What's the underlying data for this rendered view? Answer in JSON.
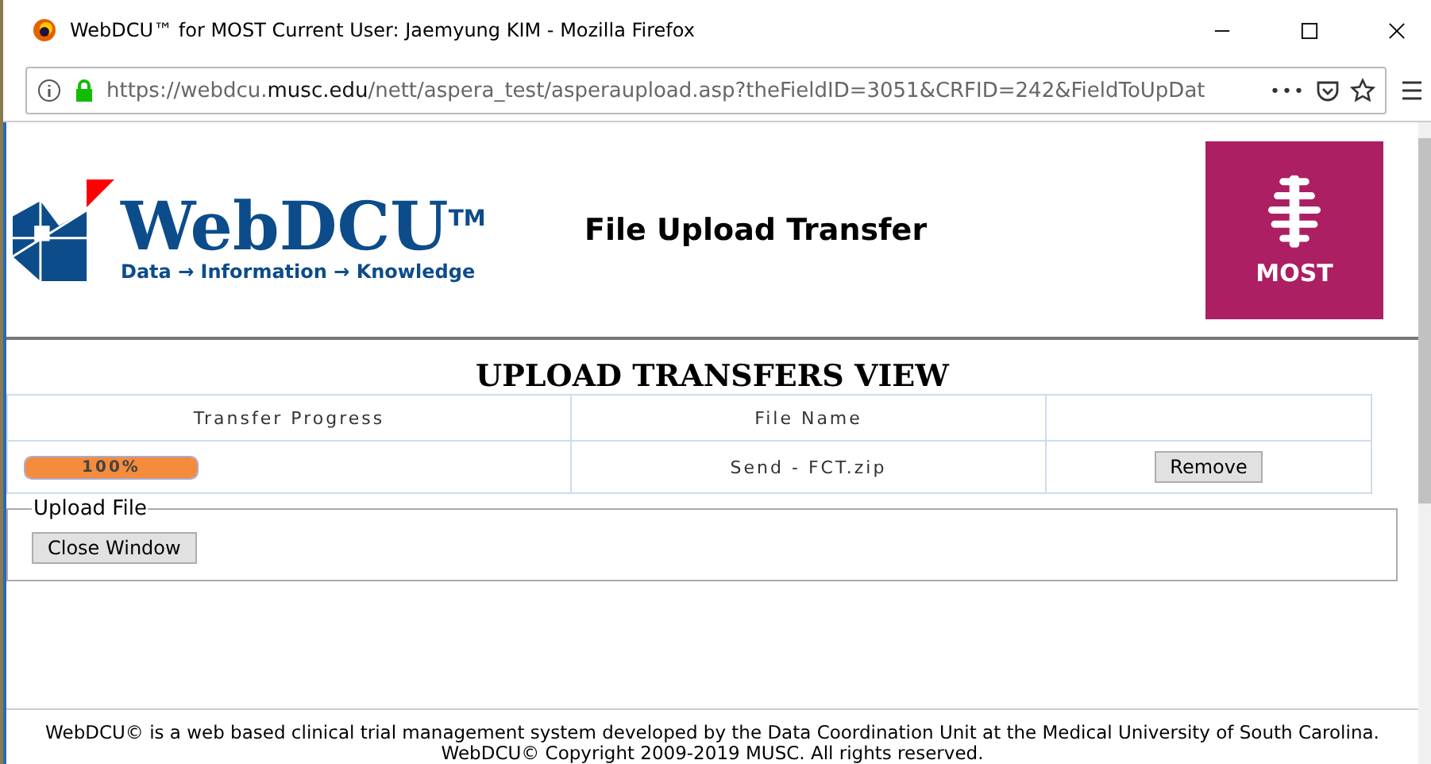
{
  "window": {
    "title": "WebDCU™ for MOST  Current User: Jaemyung KIM - Mozilla Firefox"
  },
  "address_bar": {
    "url_prefix": "https://webdcu.",
    "url_domain": "musc.edu",
    "url_rest": "/nett/aspera_test/asperaupload.asp?theFieldID=3051&CRFID=242&FieldToUpDat",
    "menu_glyph": "•••"
  },
  "header": {
    "logo_name": "WebDCU",
    "logo_tm": "TM",
    "logo_tagline": "Data → Information → Knowledge",
    "title": "File Upload Transfer",
    "badge_label": "MOST"
  },
  "heading": "UPLOAD TRANSFERS VIEW",
  "table": {
    "columns": [
      "Transfer Progress",
      "File Name"
    ],
    "rows": [
      {
        "level": 1,
        "progress_label": "100%",
        "file_name": "Send - FCT.zip",
        "action": "Remove"
      }
    ]
  },
  "upload_file": {
    "legend": "Upload File",
    "button": "Close Window"
  },
  "footer": [
    "WebDCU© is a web based clinical trial management system developed by the Data Coordination Unit at the Medical University of South Carolina.",
    "WebDCU© Copyright 2009-2019 MUSC. All rights reserved."
  ]
}
